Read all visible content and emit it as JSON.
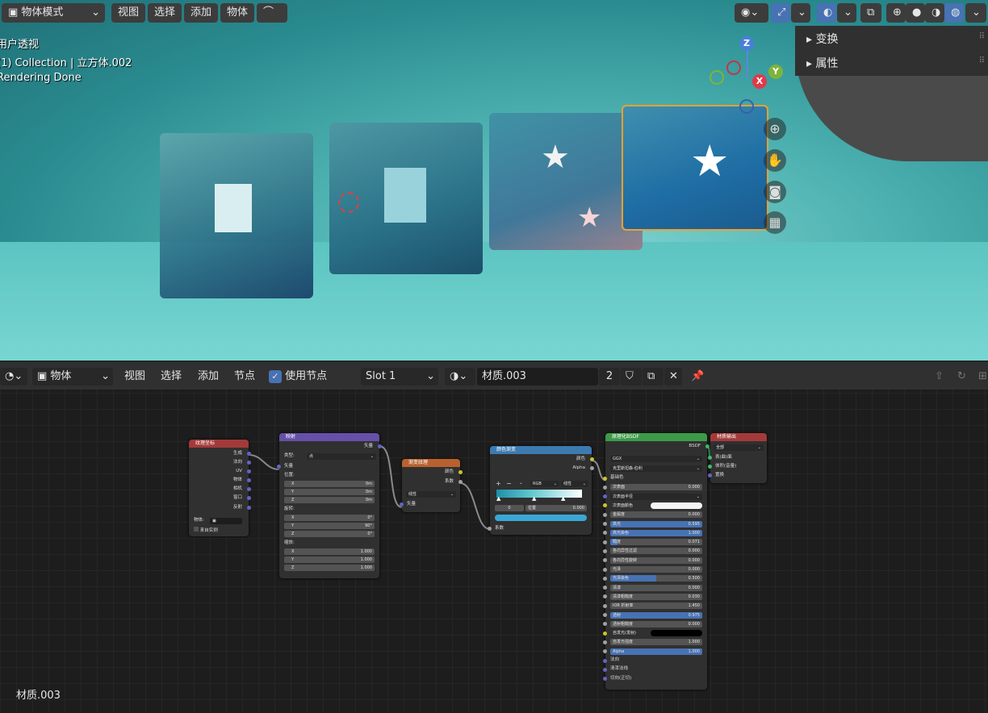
{
  "viewport": {
    "mode": "物体模式",
    "menu": [
      "视图",
      "选择",
      "添加",
      "物体"
    ],
    "overlay": [
      "用户透视",
      "(1) Collection | 立方体.002",
      "Rendering Done"
    ],
    "side_panel": [
      "变换",
      "属性"
    ],
    "gizmo": {
      "z": "Z",
      "y": "Y",
      "x": "X"
    }
  },
  "node_editor": {
    "editor_type": "物体",
    "menu": [
      "视图",
      "选择",
      "添加",
      "节点"
    ],
    "use_nodes": "使用节点",
    "slot": "Slot 1",
    "material": "材质.003",
    "users": "2",
    "footer_label": "材质.003",
    "nodes": {
      "texcoord": {
        "title": "纹理坐标",
        "outputs": [
          "生成",
          "法向",
          "UV",
          "物体",
          "相机",
          "窗口",
          "反射"
        ],
        "object_label": "物体:",
        "from_instancer": "来自实例"
      },
      "mapping": {
        "title": "映射",
        "out": "矢量",
        "type_label": "类型:",
        "type_value": "点",
        "in": "矢量",
        "loc": "位置:",
        "rot": "旋转:",
        "scale": "缩放:",
        "loc_vals": [
          [
            "X",
            "0m"
          ],
          [
            "Y",
            "0m"
          ],
          [
            "Z",
            "0m"
          ]
        ],
        "rot_vals": [
          [
            "X",
            "0°"
          ],
          [
            "Y",
            "90°"
          ],
          [
            "Z",
            "0°"
          ]
        ],
        "scale_vals": [
          [
            "X",
            "1.000"
          ],
          [
            "Y",
            "1.000"
          ],
          [
            "Z",
            "1.000"
          ]
        ]
      },
      "gradient": {
        "title": "渐变纹理",
        "out1": "颜色",
        "out2": "系数",
        "interp": "线性",
        "in": "矢量"
      },
      "ramp": {
        "title": "颜色渐变",
        "out1": "颜色",
        "out2": "Alpha",
        "mode": "RGB",
        "interp": "线性",
        "index": "0",
        "pos_label": "位置",
        "pos_value": "0.000",
        "in": "系数"
      },
      "bsdf": {
        "title": "原理化BSDF",
        "out": "BSDF",
        "dist": "GGX",
        "sss": "克里斯坦森-伯利",
        "rows": [
          [
            "基础色",
            "",
            "sock"
          ],
          [
            "次表面",
            "0.000",
            ""
          ],
          [
            "次表面半径",
            "",
            "drop"
          ],
          [
            "次表面颜色",
            "",
            "white"
          ],
          [
            "金属度",
            "0.000",
            ""
          ],
          [
            "高光",
            "0.595",
            "blue"
          ],
          [
            "高光染色",
            "1.000",
            "blue"
          ],
          [
            "糙度",
            "0.071",
            "small"
          ],
          [
            "各向异性过滤",
            "0.000",
            ""
          ],
          [
            "各向异性旋转",
            "0.000",
            ""
          ],
          [
            "光泽",
            "0.000",
            ""
          ],
          [
            "光泽染色",
            "0.500",
            "half"
          ],
          [
            "清漆",
            "0.000",
            ""
          ],
          [
            "清漆粗糙度",
            "0.030",
            ""
          ],
          [
            "IOR 折射率",
            "1.450",
            ""
          ],
          [
            "透射",
            "0.975",
            "blue"
          ],
          [
            "透射粗糙度",
            "0.000",
            ""
          ],
          [
            "自发光(发射)",
            "",
            "black"
          ],
          [
            "自发光强度",
            "1.000",
            ""
          ],
          [
            "Alpha",
            "1.000",
            "blue"
          ],
          [
            "法向",
            "",
            "sock"
          ],
          [
            "清漆法线",
            "",
            "sock"
          ],
          [
            "切向(正切)",
            "",
            "sock"
          ]
        ]
      },
      "output": {
        "title": "材质输出",
        "target": "全部",
        "inputs": [
          "表(曲)面",
          "体积(音量)",
          "置换"
        ]
      }
    }
  }
}
